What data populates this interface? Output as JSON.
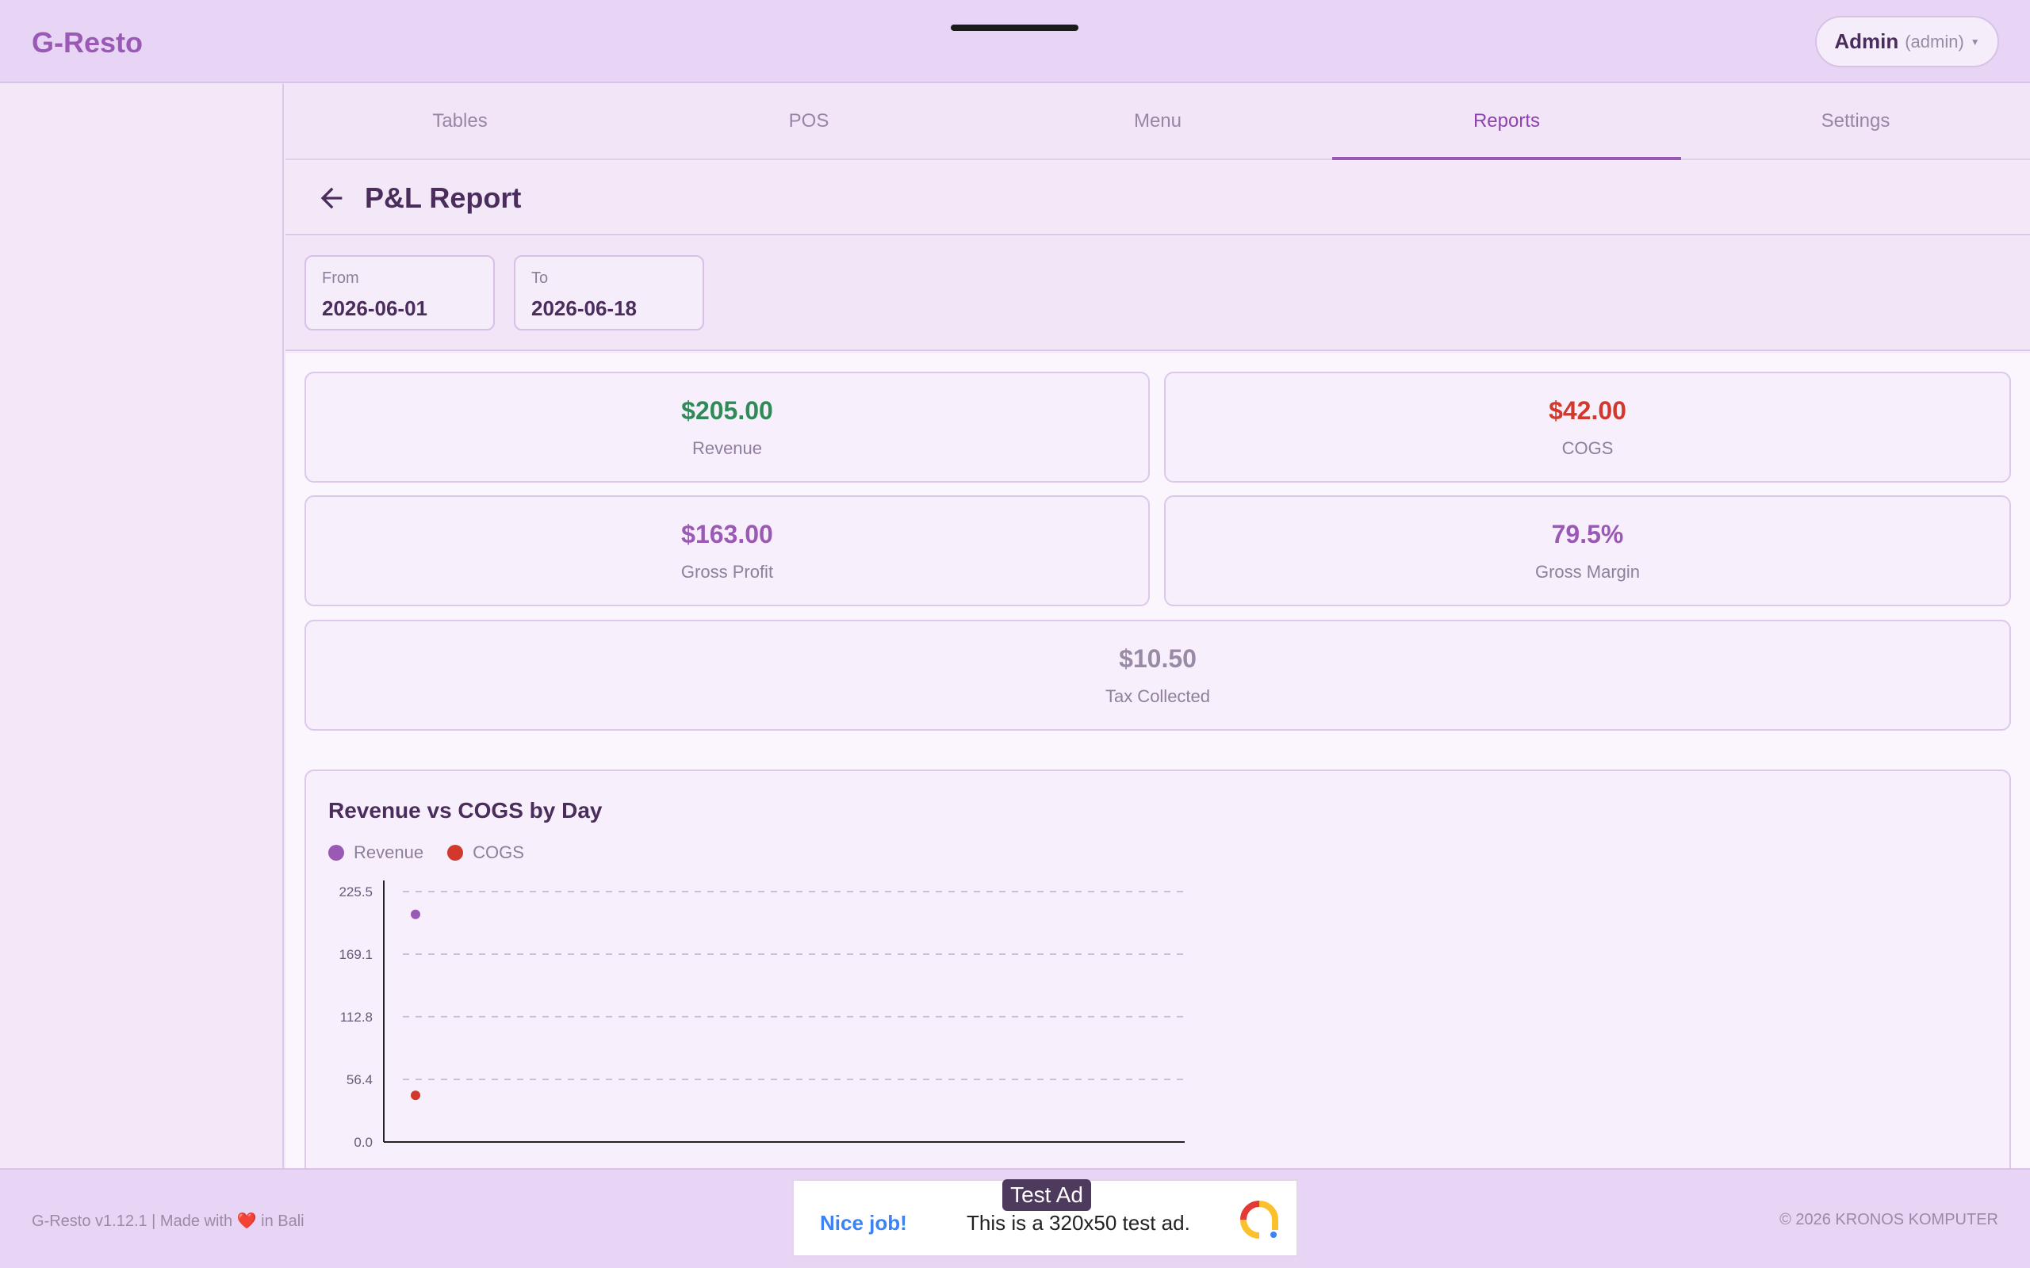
{
  "app": {
    "title": "G-Resto"
  },
  "user": {
    "name": "Admin",
    "role": "(admin)"
  },
  "tabs": [
    {
      "label": "Tables",
      "active": false
    },
    {
      "label": "POS",
      "active": false
    },
    {
      "label": "Menu",
      "active": false
    },
    {
      "label": "Reports",
      "active": true
    },
    {
      "label": "Settings",
      "active": false
    }
  ],
  "page": {
    "title": "P&L Report"
  },
  "filters": {
    "from": {
      "label": "From",
      "value": "2026-06-01"
    },
    "to": {
      "label": "To",
      "value": "2026-06-18"
    }
  },
  "summary": [
    {
      "value": "$205.00",
      "label": "Revenue",
      "color": "#2e8b57"
    },
    {
      "value": "$42.00",
      "label": "COGS",
      "color": "#d0392b"
    },
    {
      "value": "$163.00",
      "label": "Gross Profit",
      "color": "#9b59b6"
    },
    {
      "value": "79.5%",
      "label": "Gross Margin",
      "color": "#9b59b6"
    },
    {
      "value": "$10.50",
      "label": "Tax Collected",
      "color": "#9a8aa6"
    }
  ],
  "chart_data": {
    "type": "scatter",
    "title": "Revenue vs COGS by Day",
    "xlabel": "",
    "ylabel": "",
    "ylim": [
      0,
      225.5
    ],
    "y_ticks": [
      "225.5",
      "169.1",
      "112.8",
      "56.4",
      "0.0"
    ],
    "grid": true,
    "legend_position": "top-left",
    "series": [
      {
        "name": "Revenue",
        "color": "#9b59b6",
        "points": [
          {
            "x": 1,
            "y": 205
          }
        ]
      },
      {
        "name": "COGS",
        "color": "#d0392b",
        "points": [
          {
            "x": 1,
            "y": 42
          }
        ]
      }
    ]
  },
  "footer": {
    "version": "G-Resto v1.12.1 | Made with",
    "heart": "❤️",
    "location": "in Bali",
    "copyright": "© 2026 KRONOS KOMPUTER"
  },
  "ad": {
    "badge": "Test Ad",
    "headline": "Nice job!",
    "text": "This is a 320x50 test ad."
  }
}
